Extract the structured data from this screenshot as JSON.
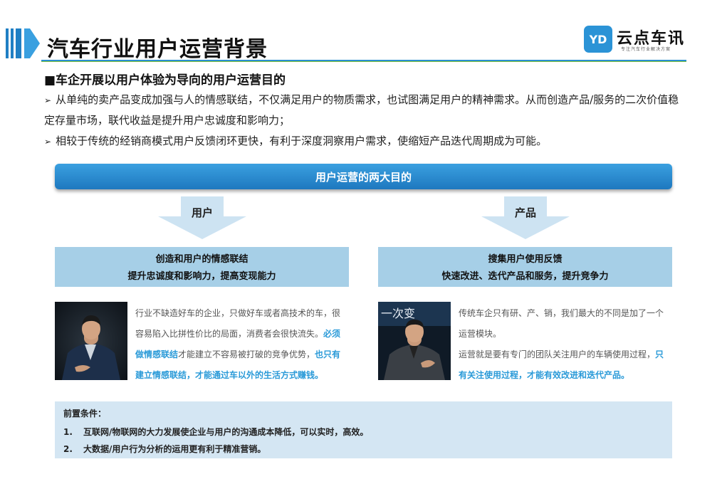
{
  "header": {
    "title": "汽车行业用户运营背景",
    "logo_mark": "YD",
    "logo_name": "云点车讯",
    "logo_tagline": "专注汽车行业解决方案"
  },
  "intro": {
    "subheading": "■车企开展以用户体验为导向的用户运营目的",
    "bullets": [
      "从单纯的卖产品变成加强与人的情感联结，不仅满足用户的物质需求，也试图满足用户的精神需求。从而创造产品/服务的二次价值稳定存量市场，联代收益是提升用户忠诚度和影响力；",
      "相较于传统的经销商模式用户反馈闭环更快，有利于深度洞察用户需求，使缩短产品迭代周期成为可能。"
    ]
  },
  "bar_label": "用户运营的两大目的",
  "left": {
    "arrow_label": "用户",
    "goal_line1": "创造和用户的情感联结",
    "goal_line2": "提升忠诚度和影响力，提高变现能力",
    "quote_normal1": "行业不缺造好车的企业，只做好车或者高技术的车，很容易陷入比拼性价比的局面，消费者会很快流失。",
    "quote_hl1": "必须做情感联结",
    "quote_normal2": "才能建立不容易被打破的竞争优势，",
    "quote_hl2": "也只有建立情感联结，才能通过车以外的生活方式赚钱。"
  },
  "right": {
    "arrow_label": "产品",
    "goal_line1": "搜集用户使用反馈",
    "goal_line2": "快速改进、迭代产品和服务，提升竞争力",
    "quote_normal1": "传统车企只有研、产、销，我们最大的不同是加了一个运营模块。",
    "quote_normal2": "运营就是要有专门的团队关注用户的车辆使用过程，",
    "quote_hl1": "只有关注使用过程，才能有效改进和迭代产品。"
  },
  "conditions": {
    "title": "前置条件：",
    "items": [
      {
        "num": "1.",
        "text": "互联网/物联网的大力发展使企业与用户的沟通成本降低，可以实时，高效。"
      },
      {
        "num": "2.",
        "text": "大数据/用户行为分析的运用更有利于精准营销。"
      }
    ]
  },
  "colors": {
    "accent_blue": "#2a9ad8",
    "bar_blue": "#1e78bf",
    "goal_box": "#a6cfe7",
    "cond_bg": "#d4e6f3"
  },
  "icons": [
    "arrow-bullet-icon",
    "down-arrow-icon",
    "logo-icon"
  ]
}
